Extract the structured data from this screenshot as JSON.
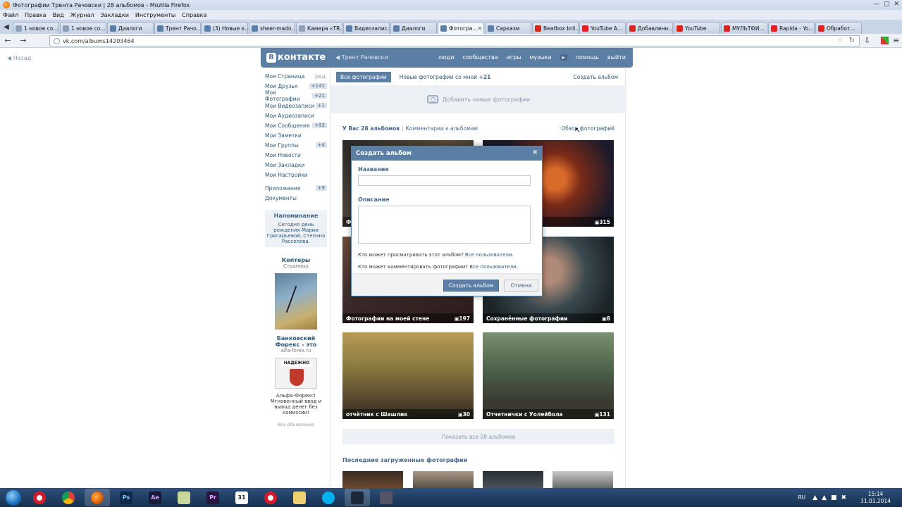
{
  "window": {
    "title": "Фотографии Трента Рачовски | 28 альбомов - Mozilla Firefox",
    "menu": [
      "Файл",
      "Правка",
      "Вид",
      "Журнал",
      "Закладки",
      "Инструменты",
      "Справка"
    ]
  },
  "tabs": [
    {
      "label": "1 новое со...",
      "icon": "doc"
    },
    {
      "label": "1 новое со...",
      "icon": "doc"
    },
    {
      "label": "Диалоги",
      "icon": "vk"
    },
    {
      "label": "Трент Рачо...",
      "icon": "vk"
    },
    {
      "label": "(3) Новые к...",
      "icon": "vk"
    },
    {
      "label": "sheer-madn...",
      "icon": "vk"
    },
    {
      "label": "Камера «TR...",
      "icon": "doc"
    },
    {
      "label": "Видеозапис...",
      "icon": "vk"
    },
    {
      "label": "Диалоги",
      "icon": "vk"
    },
    {
      "label": "Фотогра...",
      "icon": "vk",
      "active": true
    },
    {
      "label": "Сарказм",
      "icon": "vk"
    },
    {
      "label": "Beatbox bril...",
      "icon": "yt"
    },
    {
      "label": "YouTube A...",
      "icon": "yt"
    },
    {
      "label": "Добавленн...",
      "icon": "yt"
    },
    {
      "label": "YouTube",
      "icon": "yt"
    },
    {
      "label": "МУЛЬТФИ...",
      "icon": "yt"
    },
    {
      "label": "Rapida - Yo...",
      "icon": "yt"
    },
    {
      "label": "Обработ...",
      "icon": "yt"
    }
  ],
  "url": "vk.com/albums14203464",
  "page": {
    "back": "Назад",
    "header": {
      "logo": "ВКонтакте",
      "user": "Трент Рачовски",
      "nav": [
        "люди",
        "сообщества",
        "игры",
        "музыка",
        "помощь",
        "выйти"
      ]
    },
    "left_menu": [
      {
        "label": "Моя Страница",
        "badge": "ред."
      },
      {
        "label": "Мои Друзья",
        "badge": "+141"
      },
      {
        "label": "Мои Фотографии",
        "badge": "+21"
      },
      {
        "label": "Мои Видеозаписи",
        "badge": "+1"
      },
      {
        "label": "Мои Аудиозаписи",
        "badge": ""
      },
      {
        "label": "Мои Сообщения",
        "badge": "+93"
      },
      {
        "label": "Мои Заметки",
        "badge": ""
      },
      {
        "label": "Мои Группы",
        "badge": "+4"
      },
      {
        "label": "Мои Новости",
        "badge": ""
      },
      {
        "label": "Мои Закладки",
        "badge": ""
      },
      {
        "label": "Мои Настройки",
        "badge": ""
      },
      {
        "label": "Приложения",
        "badge": "+9"
      },
      {
        "label": "Документы",
        "badge": ""
      }
    ],
    "reminder": {
      "title": "Напоминание",
      "text_a": "Сегодня",
      "text_b": "день рождения",
      "text_c": "Марии Григарьевой,",
      "text_d": "Степана Рассолова."
    },
    "ad1": {
      "title": "Коптеры",
      "sub": "Страница"
    },
    "ad2": {
      "title": "Банковский Форекс - это",
      "sub": "alfa-forex.ru",
      "badge": "НАДЕЖНО",
      "text": "Альфа-Форекс! Мгновенный ввод и вывод денег без комиссии!"
    },
    "all_ads": "Все объявления",
    "tabs": {
      "all": "Все фотографии",
      "new_label": "Новые фотографии со мной",
      "new_count": "+21"
    },
    "create_album": "Создать альбом",
    "add_photos": "Добавить новые фотографии",
    "albums_bar": {
      "count": "У Вас 28 альбомов",
      "comments": "Комментарии к альбомам",
      "review": "Обзор фотографий"
    },
    "albums": [
      {
        "name": "Фо...",
        "count": ""
      },
      {
        "name": "",
        "count": "315"
      },
      {
        "name": "Фотографии на моей стене",
        "count": "197"
      },
      {
        "name": "Сохранённые фотографии",
        "count": "8"
      },
      {
        "name": "отчётник с Шашлик",
        "count": "30"
      },
      {
        "name": "Отчетнички с Уолейбола",
        "count": "131"
      }
    ],
    "show_all": "Показать все 28 альбомов",
    "recent": "Последние загруженные фотографии"
  },
  "modal": {
    "title": "Создать альбом",
    "name_label": "Название",
    "desc_label": "Описание",
    "view_q": "Кто может просматривать этот альбом?",
    "view_a": "Все пользователи",
    "comment_q": "Кто может комментировать фотографии?",
    "comment_a": "Все пользователи",
    "create_btn": "Создать альбом",
    "cancel_btn": "Отмена"
  },
  "taskbar": {
    "apps": [
      "opera",
      "chrome",
      "firefox",
      "photoshop",
      "after-effects",
      "files",
      "premiere",
      "calendar",
      "opera",
      "folder",
      "skype",
      "steam",
      "tool"
    ],
    "app_labels": {
      "photoshop": "Ps",
      "after-effects": "Ae",
      "premiere": "Pr",
      "calendar": "31"
    },
    "lang": "RU",
    "time": "15:14",
    "date": "31.01.2014"
  }
}
